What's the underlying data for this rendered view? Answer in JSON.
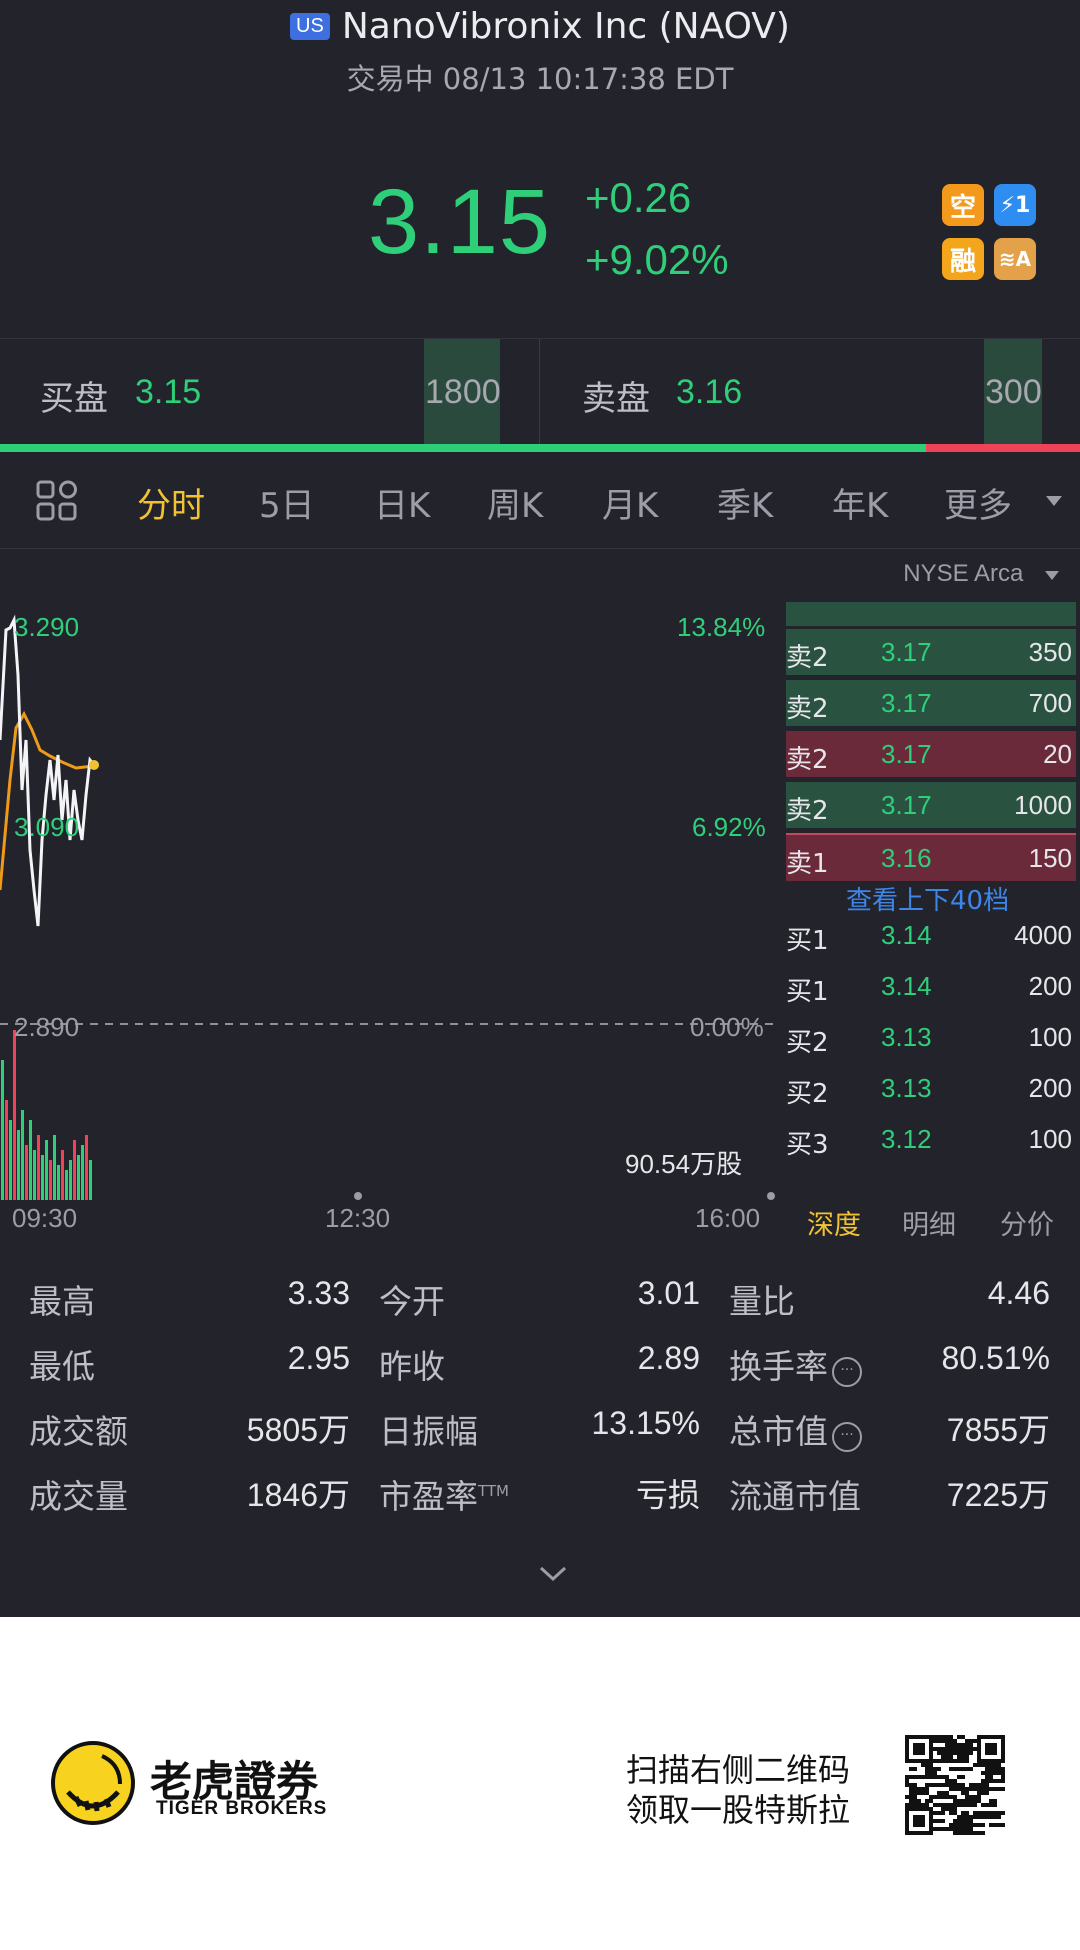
{
  "header": {
    "market_badge": "US",
    "title": "NanoVibronix Inc (NAOV)",
    "status": "交易中 08/13 10:17:38 EDT"
  },
  "quote": {
    "price": "3.15",
    "change": "+0.26",
    "change_pct": "+9.02%",
    "badges": [
      {
        "icon": "short-icon",
        "text": "空",
        "color": "#f39a1c"
      },
      {
        "icon": "lightning-icon",
        "text": "⚡1",
        "color": "#2f8cf0"
      },
      {
        "icon": "margin-icon",
        "text": "融",
        "color": "#f3a51c"
      },
      {
        "icon": "layers-icon",
        "text": "≋A",
        "color": "#e3a24a"
      }
    ]
  },
  "bidask": {
    "bid_label": "买盘",
    "bid_price": "3.15",
    "bid_vol": "1800",
    "ask_label": "卖盘",
    "ask_price": "3.16",
    "ask_vol": "300",
    "bid_ratio": 0.857
  },
  "tabs": [
    "分时",
    "5日",
    "日K",
    "周K",
    "月K",
    "季K",
    "年K",
    "更多"
  ],
  "exchange": "NYSE Arca",
  "chart": {
    "high_price": "3.290",
    "mid_price": "3.090",
    "base_price": "2.890",
    "high_pct": "13.84%",
    "mid_pct": "6.92%",
    "base_pct": "0.00%",
    "volume_label": "90.54万股",
    "times": [
      "09:30",
      "12:30",
      "16:00"
    ]
  },
  "order_book": {
    "rows": [
      {
        "label": "卖2",
        "price": "3.17",
        "vol": "350",
        "side": "ask",
        "hl": false
      },
      {
        "label": "卖2",
        "price": "3.17",
        "vol": "700",
        "side": "ask",
        "hl": false
      },
      {
        "label": "卖2",
        "price": "3.17",
        "vol": "20",
        "side": "ask",
        "hl": true
      },
      {
        "label": "卖2",
        "price": "3.17",
        "vol": "1000",
        "side": "ask",
        "hl": false
      },
      {
        "label": "卖1",
        "price": "3.16",
        "vol": "150",
        "side": "ask",
        "hl": true
      }
    ],
    "link": "查看上下40档",
    "bids": [
      {
        "label": "买1",
        "price": "3.14",
        "vol": "4000"
      },
      {
        "label": "买1",
        "price": "3.14",
        "vol": "200"
      },
      {
        "label": "买2",
        "price": "3.13",
        "vol": "100"
      },
      {
        "label": "买2",
        "price": "3.13",
        "vol": "200"
      },
      {
        "label": "买3",
        "price": "3.12",
        "vol": "100"
      }
    ],
    "tabs": [
      "深度",
      "明细",
      "分价"
    ]
  },
  "stats": [
    [
      {
        "label": "最高",
        "value": "3.33"
      },
      {
        "label": "今开",
        "value": "3.01"
      },
      {
        "label": "量比",
        "value": "4.46"
      }
    ],
    [
      {
        "label": "最低",
        "value": "2.95"
      },
      {
        "label": "昨收",
        "value": "2.89"
      },
      {
        "label": "换手率",
        "value": "80.51%"
      }
    ],
    [
      {
        "label": "成交额",
        "value": "5805万"
      },
      {
        "label": "日振幅",
        "value": "13.15%"
      },
      {
        "label": "总市值",
        "value": "7855万"
      }
    ],
    [
      {
        "label": "成交量",
        "value": "1846万"
      },
      {
        "label": "市盈率",
        "value": "亏损"
      },
      {
        "label": "流通市值",
        "value": "7225万"
      }
    ]
  ],
  "pe_suffix": "TTM",
  "footer": {
    "brand_cn": "老虎證券",
    "brand_en": "TIGER BROKERS",
    "promo_line1": "扫描右侧二维码",
    "promo_line2": "领取一股特斯拉"
  }
}
